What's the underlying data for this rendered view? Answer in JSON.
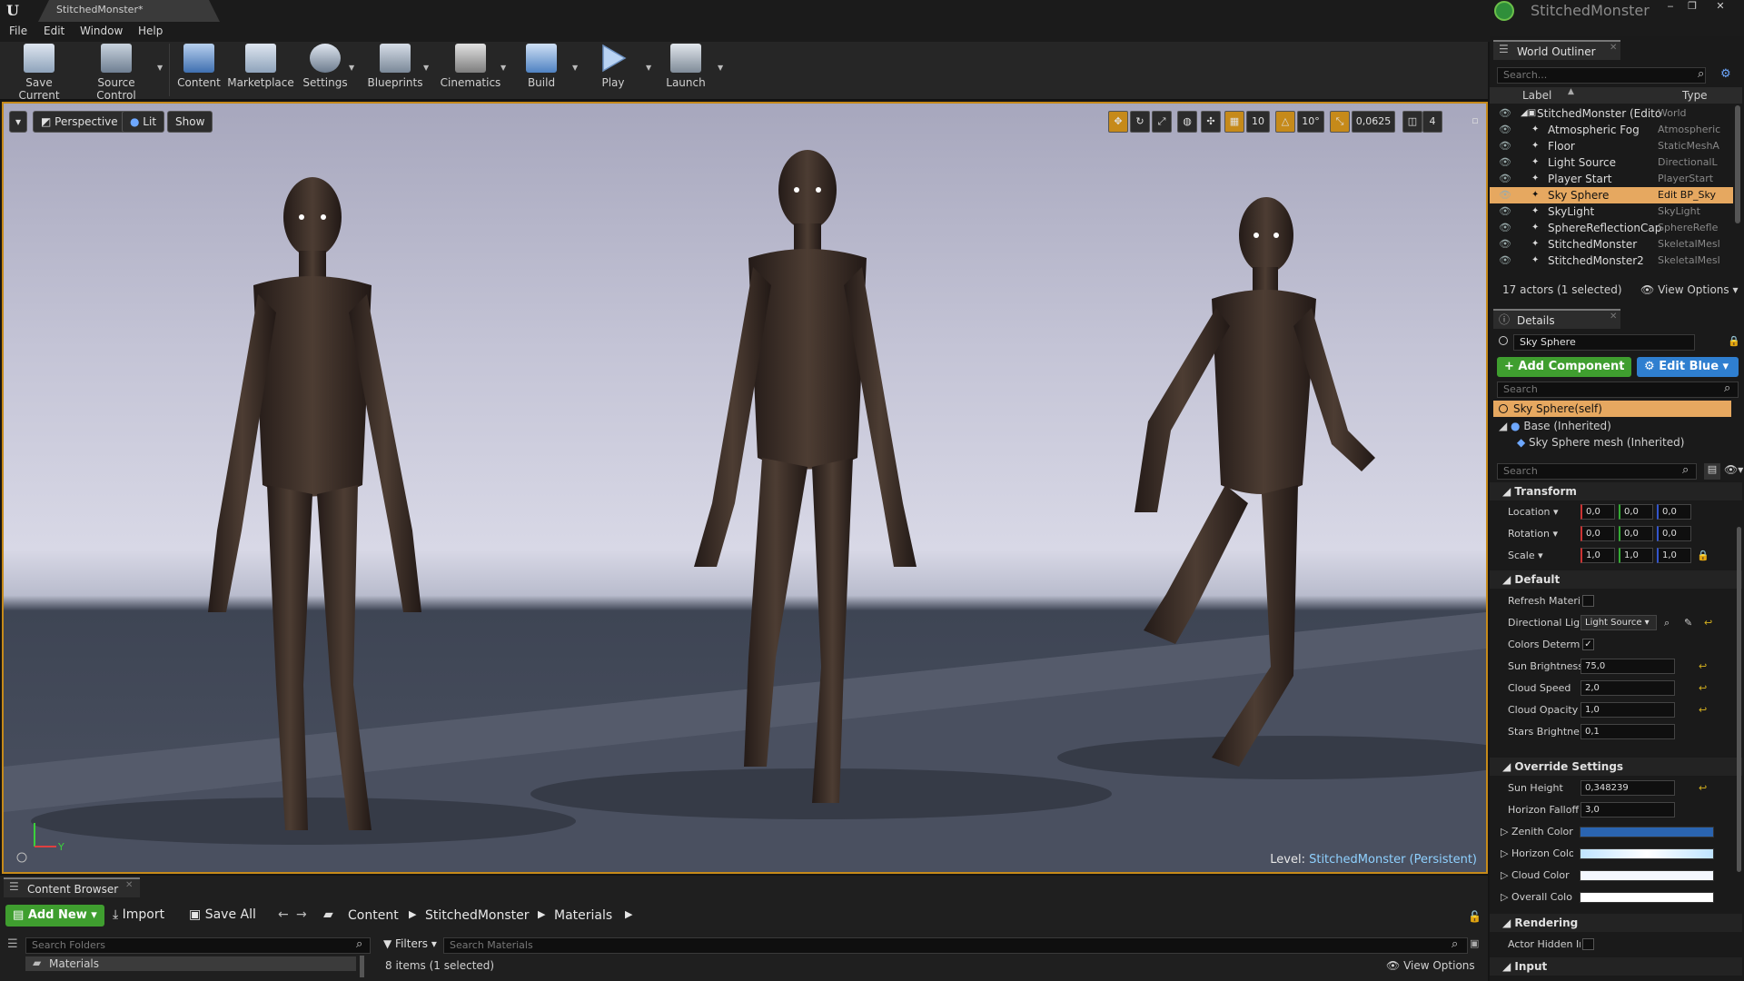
{
  "window": {
    "doc_tab": "StitchedMonster*",
    "project_title": "StitchedMonster",
    "buttons": [
      "‒",
      "❐",
      "✕"
    ]
  },
  "menu": [
    "File",
    "Edit",
    "Window",
    "Help"
  ],
  "toolbar": [
    {
      "label": "Save Current",
      "icon": "save-icon"
    },
    {
      "label": "Source Control",
      "icon": "source-control-icon"
    },
    {
      "label": "Content",
      "icon": "content-icon"
    },
    {
      "label": "Marketplace",
      "icon": "marketplace-icon"
    },
    {
      "label": "Settings",
      "icon": "settings-icon"
    },
    {
      "label": "Blueprints",
      "icon": "blueprints-icon"
    },
    {
      "label": "Cinematics",
      "icon": "cinematics-icon"
    },
    {
      "label": "Build",
      "icon": "build-icon"
    },
    {
      "label": "Play",
      "icon": "play-icon"
    },
    {
      "label": "Launch",
      "icon": "launch-icon"
    }
  ],
  "viewport": {
    "perspective": "Perspective",
    "lit": "Lit",
    "show": "Show",
    "grid_snap": "10",
    "rotation_snap": "10°",
    "scale_snap": "0,0625",
    "camera_speed": "4",
    "level_label": "Level:",
    "level_name": "StitchedMonster (Persistent)",
    "axis_y": "Y"
  },
  "outliner": {
    "tab": "World Outliner",
    "search_placeholder": "Search...",
    "col_label": "Label",
    "col_type": "Type",
    "rows": [
      {
        "label": "StitchedMonster (Edito",
        "type": "World",
        "selected": false,
        "indent": 0
      },
      {
        "label": "Atmospheric Fog",
        "type": "Atmospheric",
        "selected": false,
        "indent": 1
      },
      {
        "label": "Floor",
        "type": "StaticMeshA",
        "selected": false,
        "indent": 1
      },
      {
        "label": "Light Source",
        "type": "DirectionalL",
        "selected": false,
        "indent": 1
      },
      {
        "label": "Player Start",
        "type": "PlayerStart",
        "selected": false,
        "indent": 1
      },
      {
        "label": "Sky Sphere",
        "type": "Edit BP_Sky",
        "selected": true,
        "indent": 1
      },
      {
        "label": "SkyLight",
        "type": "SkyLight",
        "selected": false,
        "indent": 1
      },
      {
        "label": "SphereReflectionCap",
        "type": "SphereRefle",
        "selected": false,
        "indent": 1
      },
      {
        "label": "StitchedMonster",
        "type": "SkeletalMesl",
        "selected": false,
        "indent": 1
      },
      {
        "label": "StitchedMonster2",
        "type": "SkeletalMesl",
        "selected": false,
        "indent": 1
      }
    ],
    "footer": "17 actors (1 selected)",
    "view_options": "View Options"
  },
  "details": {
    "tab": "Details",
    "name": "Sky Sphere",
    "add_component": "+ Add Component",
    "edit_blueprint": "Edit Blue",
    "search_placeholder": "Search",
    "components": [
      "Sky Sphere(self)",
      "Base (Inherited)",
      "Sky Sphere mesh (Inherited)"
    ],
    "props_search_placeholder": "Search",
    "transform": {
      "header": "Transform",
      "location_label": "Location",
      "rotation_label": "Rotation",
      "scale_label": "Scale",
      "location": [
        "0,0",
        "0,0",
        "0,0"
      ],
      "rotation": [
        "0,0",
        "0,0",
        "0,0"
      ],
      "scale": [
        "1,0",
        "1,0",
        "1,0"
      ]
    },
    "default": {
      "header": "Default",
      "refresh_label": "Refresh Materi",
      "dirlight_label": "Directional Ligh",
      "dirlight_value": "Light Source",
      "colors_label": "Colors Determi",
      "sun_brightness_label": "Sun Brightness",
      "sun_brightness": "75,0",
      "cloud_speed_label": "Cloud Speed",
      "cloud_speed": "2,0",
      "cloud_opacity_label": "Cloud Opacity",
      "cloud_opacity": "1,0",
      "stars_label": "Stars Brightne",
      "stars": "0,1"
    },
    "override": {
      "header": "Override Settings",
      "sun_height_label": "Sun Height",
      "sun_height": "0,348239",
      "horizon_falloff_label": "Horizon Falloff",
      "horizon_falloff": "3,0",
      "zenith_label": "Zenith Color",
      "horizon_label": "Horizon Color",
      "cloud_color_label": "Cloud Color",
      "overall_label": "Overall Color"
    },
    "rendering": {
      "header": "Rendering",
      "actor_hidden_label": "Actor Hidden Ir"
    },
    "input": {
      "header": "Input"
    },
    "colors": {
      "zenith": "#2a64b0",
      "horizon": "#bfe4ff",
      "cloud": "#f4f8ff",
      "overall": "#ffffff"
    }
  },
  "content_browser": {
    "tab": "Content Browser",
    "add_new": "Add New",
    "import": "Import",
    "save_all": "Save All",
    "breadcrumbs": [
      "Content",
      "StitchedMonster",
      "Materials"
    ],
    "search_folders": "Search Folders",
    "filters": "Filters",
    "search_materials": "Search Materials",
    "folder": "Materials",
    "items_status": "8 items (1 selected)",
    "view_options": "View Options"
  }
}
